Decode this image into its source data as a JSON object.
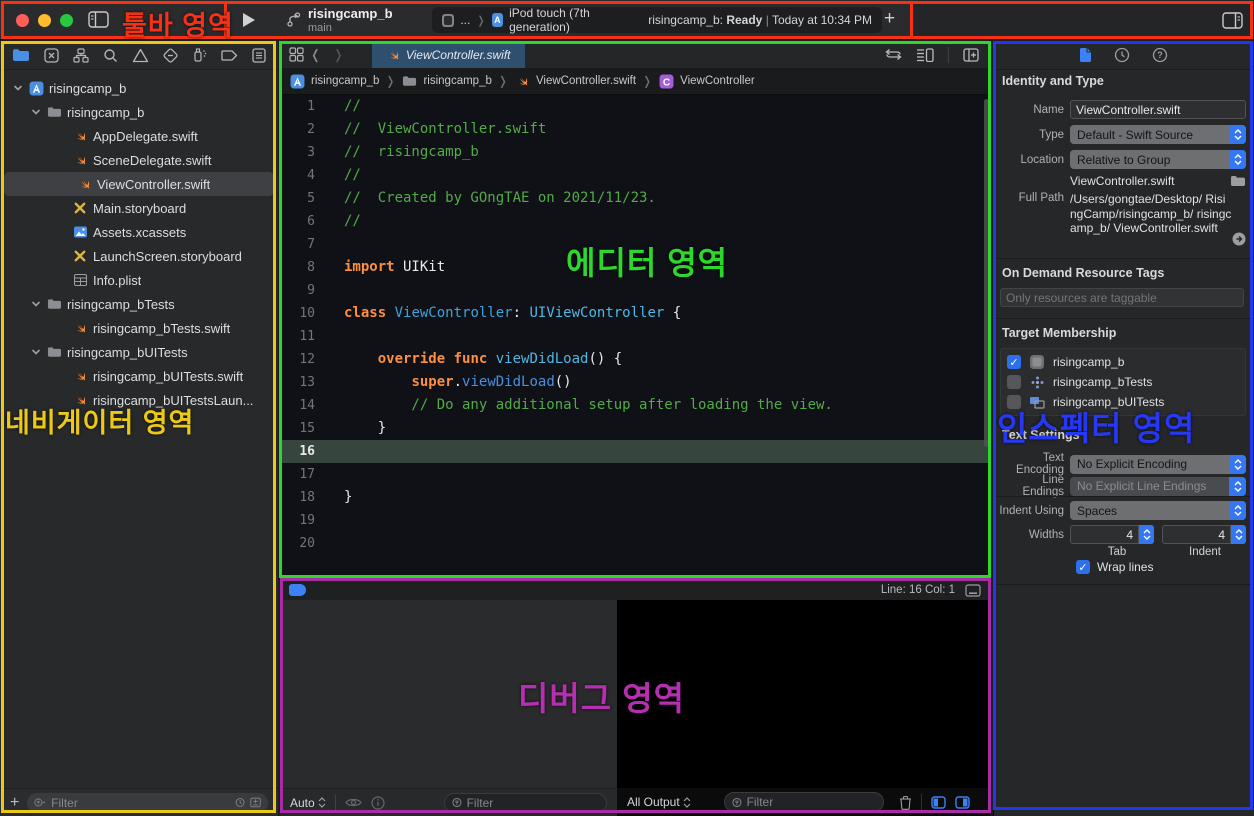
{
  "overlay": {
    "toolbar_label": "툴바 영역",
    "navigator_label": "네비게이터 영역",
    "editor_label": "에디터 영역",
    "debug_label": "디버그 영역",
    "inspector_label": "인스펙터 영역",
    "colors": {
      "toolbar": "#f83116",
      "navigator": "#ecc916",
      "editor": "#2bd82b",
      "debug": "#a92ba5",
      "inspector": "#2337ee"
    }
  },
  "toolbar": {
    "scheme_name": "risingcamp_b",
    "branch": "main",
    "device_ellipsis": "...",
    "device": "iPod touch (7th generation)",
    "status_project": "risingcamp_b:",
    "status_state": "Ready",
    "status_sep": "|",
    "status_time": "Today at 10:34 PM",
    "plus_label": "+"
  },
  "navigator": {
    "files": [
      {
        "label": "risingcamp_b",
        "icon": "project",
        "indent": 0,
        "chevron": true,
        "selected": false
      },
      {
        "label": "risingcamp_b",
        "icon": "folder",
        "indent": 1,
        "chevron": true,
        "selected": false
      },
      {
        "label": "AppDelegate.swift",
        "icon": "swift",
        "indent": 2,
        "chevron": false,
        "selected": false
      },
      {
        "label": "SceneDelegate.swift",
        "icon": "swift",
        "indent": 2,
        "chevron": false,
        "selected": false
      },
      {
        "label": "ViewController.swift",
        "icon": "swift",
        "indent": 2,
        "chevron": false,
        "selected": true
      },
      {
        "label": "Main.storyboard",
        "icon": "storyboard",
        "indent": 2,
        "chevron": false,
        "selected": false
      },
      {
        "label": "Assets.xcassets",
        "icon": "assets",
        "indent": 2,
        "chevron": false,
        "selected": false
      },
      {
        "label": "LaunchScreen.storyboard",
        "icon": "storyboard",
        "indent": 2,
        "chevron": false,
        "selected": false
      },
      {
        "label": "Info.plist",
        "icon": "plist",
        "indent": 2,
        "chevron": false,
        "selected": false
      },
      {
        "label": "risingcamp_bTests",
        "icon": "folder",
        "indent": 1,
        "chevron": true,
        "selected": false
      },
      {
        "label": "risingcamp_bTests.swift",
        "icon": "swift",
        "indent": 2,
        "chevron": false,
        "selected": false
      },
      {
        "label": "risingcamp_bUITests",
        "icon": "folder",
        "indent": 1,
        "chevron": true,
        "selected": false
      },
      {
        "label": "risingcamp_bUITests.swift",
        "icon": "swift",
        "indent": 2,
        "chevron": false,
        "selected": false
      },
      {
        "label": "risingcamp_bUITestsLaun...",
        "icon": "swift",
        "indent": 2,
        "chevron": false,
        "selected": false
      }
    ],
    "filter_placeholder": "Filter"
  },
  "editor": {
    "tab_title": "ViewController.swift",
    "breadcrumbs": [
      {
        "label": "risingcamp_b",
        "icon": "project"
      },
      {
        "label": "risingcamp_b",
        "icon": "folder"
      },
      {
        "label": "ViewController.swift",
        "icon": "swift"
      },
      {
        "label": "ViewController",
        "icon": "csymbol"
      }
    ],
    "current_line": 16,
    "code": [
      {
        "n": 1,
        "segs": [
          [
            "//",
            "cm"
          ]
        ]
      },
      {
        "n": 2,
        "segs": [
          [
            "//  ViewController.swift",
            "cm"
          ]
        ]
      },
      {
        "n": 3,
        "segs": [
          [
            "//  risingcamp_b",
            "cm"
          ]
        ]
      },
      {
        "n": 4,
        "segs": [
          [
            "//",
            "cm"
          ]
        ]
      },
      {
        "n": 5,
        "segs": [
          [
            "//  Created by GOngTAE on 2021/11/23.",
            "cm"
          ]
        ]
      },
      {
        "n": 6,
        "segs": [
          [
            "//",
            "cm"
          ]
        ]
      },
      {
        "n": 7,
        "segs": []
      },
      {
        "n": 8,
        "segs": [
          [
            "import",
            "kw"
          ],
          [
            " UIKit",
            "pl"
          ]
        ]
      },
      {
        "n": 9,
        "segs": []
      },
      {
        "n": 10,
        "segs": [
          [
            "class",
            "kw"
          ],
          [
            " ",
            "pl"
          ],
          [
            "ViewController",
            "ty"
          ],
          [
            ": ",
            "pl"
          ],
          [
            "UIViewController",
            "tyr"
          ],
          [
            " {",
            "pl"
          ]
        ]
      },
      {
        "n": 11,
        "segs": []
      },
      {
        "n": 12,
        "segs": [
          [
            "    ",
            "pl"
          ],
          [
            "override",
            "kw"
          ],
          [
            " ",
            "pl"
          ],
          [
            "func",
            "kw"
          ],
          [
            " ",
            "pl"
          ],
          [
            "viewDidLoad",
            "fn"
          ],
          [
            "() {",
            "pl"
          ]
        ]
      },
      {
        "n": 13,
        "segs": [
          [
            "        ",
            "pl"
          ],
          [
            "super",
            "kw"
          ],
          [
            ".",
            "pl"
          ],
          [
            "viewDidLoad",
            "fc"
          ],
          [
            "()",
            "pl"
          ]
        ]
      },
      {
        "n": 14,
        "segs": [
          [
            "        // Do any additional setup after loading the view.",
            "cm"
          ]
        ]
      },
      {
        "n": 15,
        "segs": [
          [
            "    }",
            "pl"
          ]
        ]
      },
      {
        "n": 16,
        "segs": []
      },
      {
        "n": 17,
        "segs": []
      },
      {
        "n": 18,
        "segs": [
          [
            "}",
            "pl"
          ]
        ]
      },
      {
        "n": 19,
        "segs": []
      },
      {
        "n": 20,
        "segs": []
      }
    ],
    "line_col": "Line: 16  Col: 1"
  },
  "debug": {
    "variables_scope": "Auto",
    "console_scope": "All Output",
    "filter_placeholder": "Filter"
  },
  "inspector": {
    "identity_header": "Identity and Type",
    "name_label": "Name",
    "name_value": "ViewController.swift",
    "type_label": "Type",
    "type_value": "Default - Swift Source",
    "location_label": "Location",
    "location_value": "Relative to Group",
    "location_file": "ViewController.swift",
    "fullpath_label": "Full Path",
    "fullpath_value": "/Users/gongtae/Desktop/ RisingCamp/risingcamp_b/ risingcamp_b/ ViewController.swift",
    "odrt_header": "On Demand Resource Tags",
    "odrt_placeholder": "Only resources are taggable",
    "target_header": "Target Membership",
    "targets": [
      {
        "label": "risingcamp_b",
        "icon": "app",
        "checked": true
      },
      {
        "label": "risingcamp_bTests",
        "icon": "tests",
        "checked": false
      },
      {
        "label": "risingcamp_bUITests",
        "icon": "uitests",
        "checked": false
      }
    ],
    "textsettings_header": "Text Settings",
    "encoding_label": "Text Encoding",
    "encoding_value": "No Explicit Encoding",
    "lineendings_label": "Line Endings",
    "lineendings_value": "No Explicit Line Endings",
    "indent_label": "Indent Using",
    "indent_value": "Spaces",
    "widths_label": "Widths",
    "tab_width": "4",
    "tab_caption": "Tab",
    "indent_width": "4",
    "indent_caption": "Indent",
    "wrap_label": "Wrap lines"
  }
}
